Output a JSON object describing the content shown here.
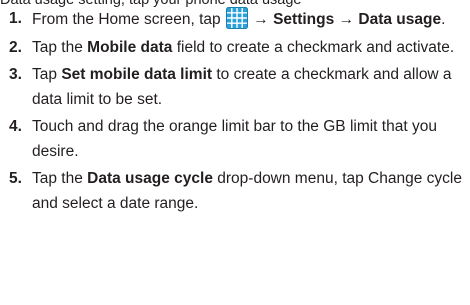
{
  "cut_line": "Data usage setting, tap your phone data usage",
  "steps": [
    {
      "num": "1.",
      "pre": "From the Home screen, tap ",
      "icon": "apps-grid-icon",
      "arrow1": "→",
      "settings": "Settings",
      "arrow2": "→",
      "target": "Data usage",
      "post": "."
    },
    {
      "num": "2.",
      "pre": "Tap the ",
      "bold": "Mobile data",
      "post": " field to create a checkmark and activate."
    },
    {
      "num": "3.",
      "pre": "Tap ",
      "bold": "Set mobile data limit",
      "post": " to create a checkmark and allow a data limit to be set."
    },
    {
      "num": "4.",
      "text": "Touch and drag the orange limit bar to the GB limit that you desire."
    },
    {
      "num": "5.",
      "pre": "Tap the ",
      "bold": "Data usage cycle",
      "post": " drop-down menu, tap Change cycle and select a date range."
    }
  ],
  "colors": {
    "text": "#231f20",
    "icon_fill": "#2aa1d9",
    "icon_border": "#1a7fb3"
  }
}
